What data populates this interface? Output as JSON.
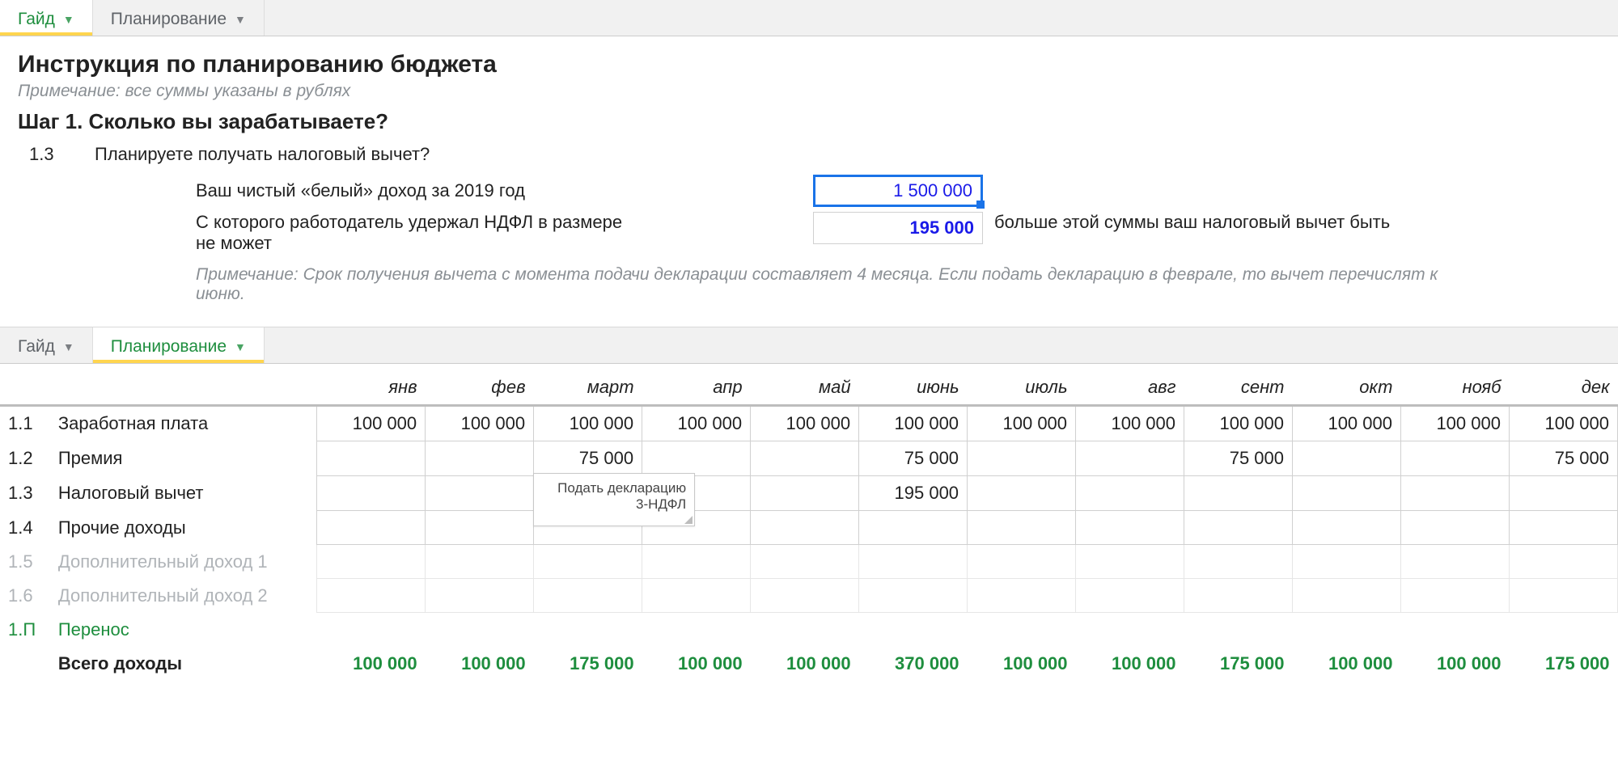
{
  "tabs_top": {
    "guide": "Гайд",
    "planning": "Планирование"
  },
  "doc": {
    "title": "Инструкция по планированию бюджета",
    "note_top": "Примечание: все суммы указаны в рублях",
    "step1_heading": "Шаг 1. Сколько вы зарабатываете?",
    "step_1_3_num": "1.3",
    "step_1_3_text": "Планируете получать налоговый вычет?",
    "income_label": "Ваш чистый «белый» доход за 2019 год",
    "income_value": "1 500 000",
    "ndfl_label": "С которого работодатель удержал НДФЛ в размере не может",
    "ndfl_label_part1": "С которого работодатель удержал НДФЛ в размере",
    "ndfl_label_part2": "не может",
    "ndfl_value": "195 000",
    "ndfl_after": "больше этой суммы ваш налоговый вычет быть",
    "note_bottom": "Примечание: Срок получения вычета с момента подачи декларации составляет 4 месяца. Если подать декларацию в феврале, то вычет перечислят к июню."
  },
  "tabs_bottom": {
    "guide": "Гайд",
    "planning": "Планирование"
  },
  "plan": {
    "months": [
      "янв",
      "фев",
      "март",
      "апр",
      "май",
      "июнь",
      "июль",
      "авг",
      "сент",
      "окт",
      "нояб",
      "дек"
    ],
    "rows": [
      {
        "idx": "1.1",
        "label": "Заработная плата",
        "vals": [
          "100 000",
          "100 000",
          "100 000",
          "100 000",
          "100 000",
          "100 000",
          "100 000",
          "100 000",
          "100 000",
          "100 000",
          "100 000",
          "100 000"
        ],
        "cls": ""
      },
      {
        "idx": "1.2",
        "label": "Премия",
        "vals": [
          "",
          "",
          "75 000",
          "",
          "",
          "75 000",
          "",
          "",
          "75 000",
          "",
          "",
          "75 000"
        ],
        "cls": ""
      },
      {
        "idx": "1.3",
        "label": "Налоговый вычет",
        "vals": [
          "",
          "",
          "",
          "",
          "",
          "195 000",
          "",
          "",
          "",
          "",
          "",
          ""
        ],
        "cls": ""
      },
      {
        "idx": "1.4",
        "label": "Прочие доходы",
        "vals": [
          "",
          "",
          "",
          "",
          "",
          "",
          "",
          "",
          "",
          "",
          "",
          ""
        ],
        "cls": ""
      },
      {
        "idx": "1.5",
        "label": "Дополнительный доход 1",
        "vals": [
          "",
          "",
          "",
          "",
          "",
          "",
          "",
          "",
          "",
          "",
          "",
          ""
        ],
        "cls": "muted"
      },
      {
        "idx": "1.6",
        "label": "Дополнительный доход 2",
        "vals": [
          "",
          "",
          "",
          "",
          "",
          "",
          "",
          "",
          "",
          "",
          "",
          ""
        ],
        "cls": "muted"
      },
      {
        "idx": "1.П",
        "label": "Перенос",
        "vals": [
          "",
          "",
          "",
          "",
          "",
          "",
          "",
          "",
          "",
          "",
          "",
          ""
        ],
        "cls": "green"
      },
      {
        "idx": "",
        "label": "Всего доходы",
        "vals": [
          "100 000",
          "100 000",
          "175 000",
          "100 000",
          "100 000",
          "370 000",
          "100 000",
          "100 000",
          "175 000",
          "100 000",
          "100 000",
          "175 000"
        ],
        "cls": "total"
      }
    ],
    "cell_note": "Подать декларацию 3-НДФЛ"
  }
}
